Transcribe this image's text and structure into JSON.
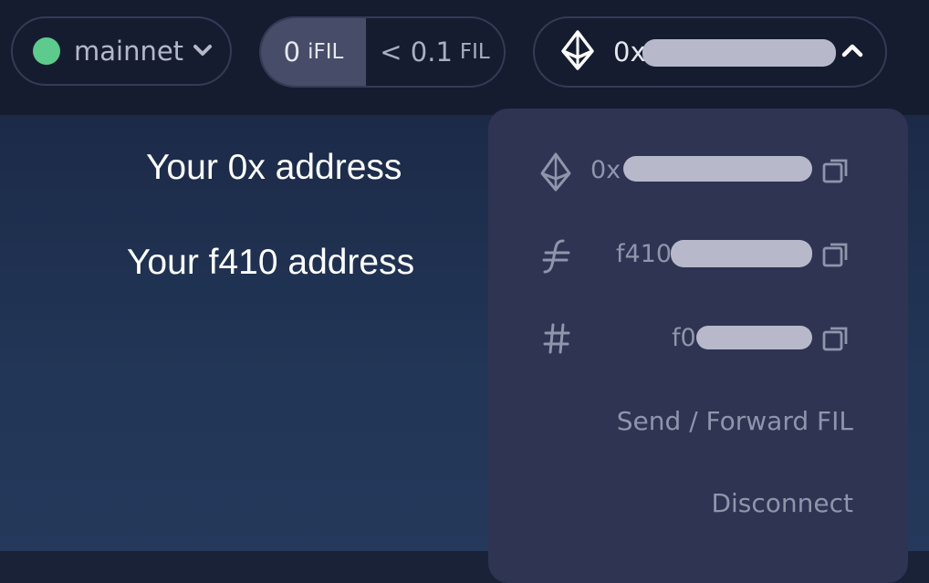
{
  "network": {
    "name": "mainnet",
    "status_color": "#5ccb8d"
  },
  "balances": {
    "ifil": {
      "amount": "0",
      "unit": "iFIL"
    },
    "fil": {
      "amount": "< 0.1",
      "unit": "FIL"
    }
  },
  "account": {
    "address_prefix": "0x",
    "icon": "ethereum-icon"
  },
  "annotations": {
    "label_0x": "Your 0x address",
    "label_f410": "Your f410 address"
  },
  "dropdown": {
    "addresses": [
      {
        "icon": "ethereum-icon",
        "prefix": "0x"
      },
      {
        "icon": "filecoin-icon",
        "prefix": "f410"
      },
      {
        "icon": "hash-icon",
        "prefix": "f0"
      }
    ],
    "actions": {
      "send": "Send / Forward FIL",
      "disconnect": "Disconnect"
    }
  }
}
